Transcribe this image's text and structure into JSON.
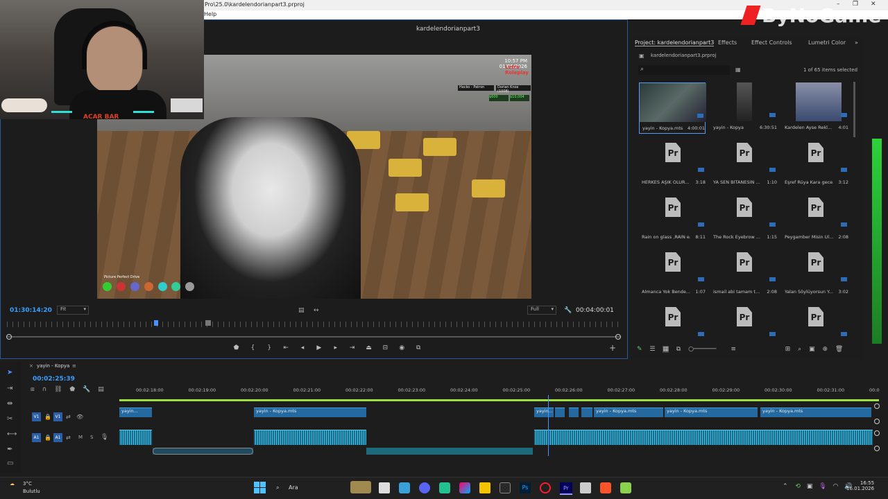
{
  "window": {
    "title": "Pro\\25.0\\kardelendorianpart3.prproj",
    "menu_help": "Help"
  },
  "overlay": {
    "brand": "ByNoGame",
    "webcam_tag": "ACAR BAR"
  },
  "program_monitor": {
    "title": "kardelendorianpart3",
    "timecode_current": "01:30:14:20",
    "fit_label": "Fit",
    "resolution_label": "Full",
    "timecode_duration": "00:04:00:01"
  },
  "video_hud": {
    "time": "10:57 PM",
    "date": "01/05/2026",
    "server": "Letro Roleplay",
    "left_tag": "Hacko - Patron",
    "right_tag": "Dorian Knox (1008)",
    "cash": "$600",
    "bank": "$10,004",
    "bottom_label": "Picture Perfect Drive"
  },
  "project_panel": {
    "tabs": [
      "Project: kardelendorianpart3",
      "Effects",
      "Effect Controls",
      "Lumetri Color"
    ],
    "file": "kardelendorianpart3.prproj",
    "search_placeholder": "",
    "selection_count": "1 of 65 items selected",
    "items": [
      {
        "name": "yayin - Kopya.mts",
        "duration": "4:00:01",
        "thumb": "video"
      },
      {
        "name": "yayin - Kopya",
        "duration": "6:30:51",
        "thumb": "sequence"
      },
      {
        "name": "Kardelen Ayse Rekl...",
        "duration": "4:01",
        "thumb": "classroom"
      },
      {
        "name": "HERKES AŞIK OLUR...",
        "duration": "3:18",
        "thumb": "pr"
      },
      {
        "name": "YA SEN BITANESIN ...",
        "duration": "1:10",
        "thumb": "pr"
      },
      {
        "name": "Eşref Rüya Kara gece...",
        "duration": "3:12",
        "thumb": "pr"
      },
      {
        "name": "Rain on glass ,RAIN e...",
        "duration": "8:11",
        "thumb": "pr"
      },
      {
        "name": "The Rock Eyebrow ...",
        "duration": "1:15",
        "thumb": "pr"
      },
      {
        "name": "Peygamber Misin Ul...",
        "duration": "2:08",
        "thumb": "pr"
      },
      {
        "name": "Almanca Yok Bende...",
        "duration": "1:07",
        "thumb": "pr"
      },
      {
        "name": "ismail abi tamam t...",
        "duration": "2:08",
        "thumb": "pr"
      },
      {
        "name": "Yalan Söylüyorsun Y...",
        "duration": "3:02",
        "thumb": "pr"
      },
      {
        "name": "",
        "duration": "",
        "thumb": "pr"
      },
      {
        "name": "",
        "duration": "",
        "thumb": "pr"
      },
      {
        "name": "",
        "duration": "",
        "thumb": "pr"
      }
    ]
  },
  "timeline": {
    "sequence_name": "yayin - Kopya",
    "timecode": "00:02:25:39",
    "ruler_ticks": [
      "00:02:18:00",
      "00:02:19:00",
      "00:02:20:00",
      "00:02:21:00",
      "00:02:22:00",
      "00:02:23:00",
      "00:02:24:00",
      "00:02:25:00",
      "00:02:26:00",
      "00:02:27:00",
      "00:02:28:00",
      "00:02:29:00",
      "00:02:30:00",
      "00:02:31:00",
      "00:0"
    ],
    "tracks": {
      "v1_target": "V1",
      "v1_label": "V1",
      "a1_target": "A1",
      "a1_label": "A1",
      "mute": "M",
      "solo": "S"
    },
    "video_clips": [
      "yayin...",
      "yayin - Kopya.mts",
      "yayin...",
      "yayin - Kopya.mts",
      "yayin - Kopya.mts",
      "yayin - Kopya.mts"
    ]
  },
  "taskbar": {
    "temperature": "3°C",
    "weather": "Bulutlu",
    "search": "Ara",
    "time": "16:55",
    "date": "16.01.2026"
  }
}
